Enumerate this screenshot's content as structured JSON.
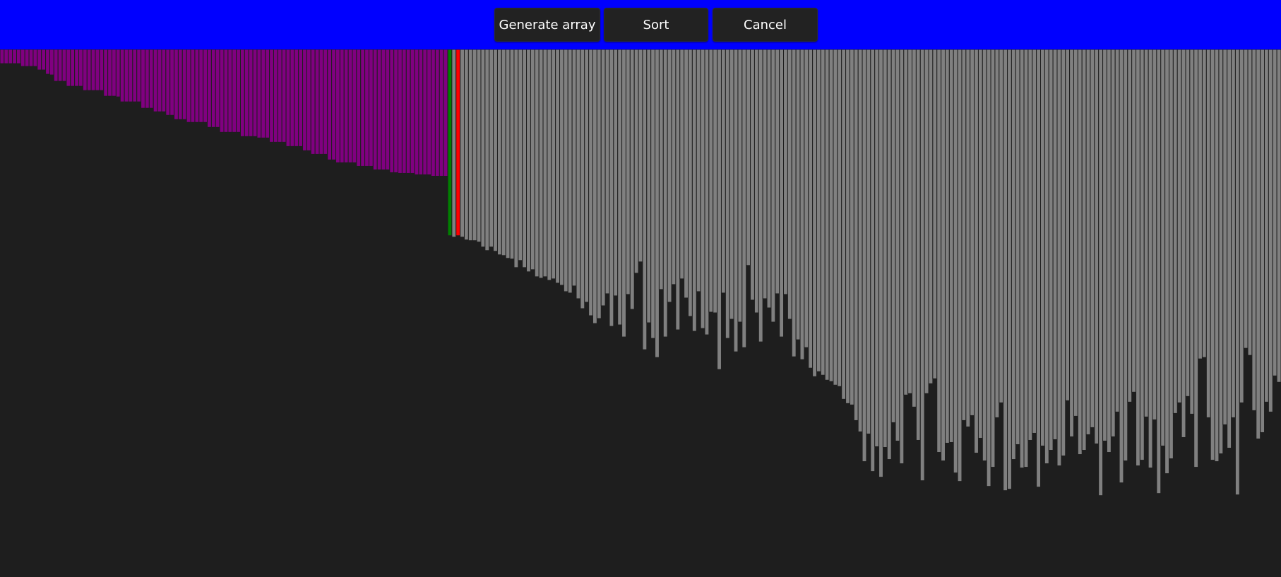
{
  "toolbar": {
    "background_color": "#0000ff",
    "buttons": {
      "generate_label": "Generate array",
      "sort_label": "Sort",
      "cancel_label": "Cancel"
    }
  },
  "visualizer": {
    "background_color": "#1e1e1e",
    "bar_count": 300,
    "colors": {
      "sorted": "#800080",
      "compare": "#008000",
      "active": "#ff0000",
      "unsorted": "#808080",
      "outline": "#1e1e1e"
    },
    "sorted_count": 108,
    "compare_indices": [
      108
    ],
    "active_indices": [
      110
    ],
    "value_max": 745,
    "values": [
      20,
      20,
      20,
      20,
      20,
      24,
      24,
      24,
      24,
      29,
      29,
      35,
      36,
      45,
      45,
      45,
      52,
      52,
      52,
      52,
      58,
      58,
      58,
      58,
      58,
      66,
      66,
      66,
      67,
      74,
      74,
      74,
      74,
      74,
      83,
      83,
      83,
      88,
      88,
      88,
      93,
      93,
      99,
      99,
      99,
      103,
      103,
      103,
      103,
      103,
      110,
      110,
      110,
      117,
      117,
      117,
      117,
      117,
      123,
      123,
      123,
      123,
      125,
      125,
      125,
      131,
      131,
      131,
      131,
      137,
      137,
      137,
      137,
      143,
      143,
      148,
      148,
      148,
      148,
      156,
      156,
      160,
      160,
      160,
      160,
      160,
      165,
      165,
      165,
      165,
      170,
      170,
      170,
      170,
      174,
      174,
      175,
      175,
      175,
      175,
      177,
      177,
      177,
      177,
      179,
      179,
      179,
      179,
      263,
      265,
      263,
      265,
      269,
      270,
      270,
      272,
      279,
      284,
      279,
      285,
      290,
      291,
      295,
      296,
      308,
      298,
      308,
      314,
      311,
      321,
      323,
      321,
      326,
      324,
      330,
      333,
      342,
      344,
      334,
      352,
      366,
      357,
      376,
      387,
      380,
      362,
      345,
      391,
      348,
      389,
      406,
      346,
      367,
      316,
      300,
      424,
      386,
      408,
      435,
      339,
      406,
      357,
      332,
      396,
      324,
      351,
      377,
      398,
      342,
      394,
      403,
      371,
      372,
      452,
      344,
      408,
      381,
      427,
      385,
      421,
      305,
      354,
      372,
      413,
      352,
      365,
      385,
      345,
      406,
      346,
      381,
      434,
      410,
      438,
      421,
      450,
      462,
      455,
      460,
      467,
      469,
      474,
      476,
      494,
      500,
      502,
      524,
      540,
      582,
      543,
      596,
      561,
      604,
      562,
      579,
      527,
      553,
      585,
      488,
      486,
      505,
      552,
      609,
      486,
      472,
      465,
      569,
      581,
      556,
      555,
      598,
      610,
      524,
      533,
      517,
      570,
      549,
      581,
      617,
      590,
      520,
      499,
      623,
      621,
      579,
      558,
      591,
      590,
      552,
      542,
      618,
      560,
      585,
      566,
      551,
      588,
      574,
      496,
      547,
      518,
      572,
      566,
      544,
      534,
      557,
      630,
      553,
      569,
      547,
      512,
      612,
      581,
      498,
      484,
      588,
      580,
      519,
      591,
      523,
      627,
      560,
      599,
      578,
      514,
      499,
      548,
      490,
      515,
      590,
      437,
      435,
      520,
      580,
      582,
      571,
      530,
      563,
      520,
      629,
      499,
      422,
      432,
      510,
      550,
      541,
      498,
      512,
      461,
      470
    ]
  }
}
